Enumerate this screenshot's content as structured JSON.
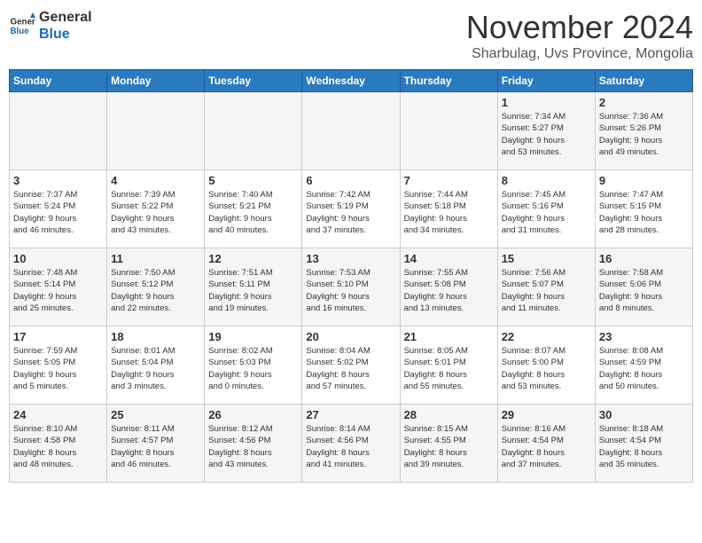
{
  "logo": {
    "general": "General",
    "blue": "Blue"
  },
  "title": "November 2024",
  "location": "Sharbulag, Uvs Province, Mongolia",
  "days_header": [
    "Sunday",
    "Monday",
    "Tuesday",
    "Wednesday",
    "Thursday",
    "Friday",
    "Saturday"
  ],
  "weeks": [
    [
      {
        "day": "",
        "info": ""
      },
      {
        "day": "",
        "info": ""
      },
      {
        "day": "",
        "info": ""
      },
      {
        "day": "",
        "info": ""
      },
      {
        "day": "",
        "info": ""
      },
      {
        "day": "1",
        "info": "Sunrise: 7:34 AM\nSunset: 5:27 PM\nDaylight: 9 hours\nand 53 minutes."
      },
      {
        "day": "2",
        "info": "Sunrise: 7:36 AM\nSunset: 5:26 PM\nDaylight: 9 hours\nand 49 minutes."
      }
    ],
    [
      {
        "day": "3",
        "info": "Sunrise: 7:37 AM\nSunset: 5:24 PM\nDaylight: 9 hours\nand 46 minutes."
      },
      {
        "day": "4",
        "info": "Sunrise: 7:39 AM\nSunset: 5:22 PM\nDaylight: 9 hours\nand 43 minutes."
      },
      {
        "day": "5",
        "info": "Sunrise: 7:40 AM\nSunset: 5:21 PM\nDaylight: 9 hours\nand 40 minutes."
      },
      {
        "day": "6",
        "info": "Sunrise: 7:42 AM\nSunset: 5:19 PM\nDaylight: 9 hours\nand 37 minutes."
      },
      {
        "day": "7",
        "info": "Sunrise: 7:44 AM\nSunset: 5:18 PM\nDaylight: 9 hours\nand 34 minutes."
      },
      {
        "day": "8",
        "info": "Sunrise: 7:45 AM\nSunset: 5:16 PM\nDaylight: 9 hours\nand 31 minutes."
      },
      {
        "day": "9",
        "info": "Sunrise: 7:47 AM\nSunset: 5:15 PM\nDaylight: 9 hours\nand 28 minutes."
      }
    ],
    [
      {
        "day": "10",
        "info": "Sunrise: 7:48 AM\nSunset: 5:14 PM\nDaylight: 9 hours\nand 25 minutes."
      },
      {
        "day": "11",
        "info": "Sunrise: 7:50 AM\nSunset: 5:12 PM\nDaylight: 9 hours\nand 22 minutes."
      },
      {
        "day": "12",
        "info": "Sunrise: 7:51 AM\nSunset: 5:11 PM\nDaylight: 9 hours\nand 19 minutes."
      },
      {
        "day": "13",
        "info": "Sunrise: 7:53 AM\nSunset: 5:10 PM\nDaylight: 9 hours\nand 16 minutes."
      },
      {
        "day": "14",
        "info": "Sunrise: 7:55 AM\nSunset: 5:08 PM\nDaylight: 9 hours\nand 13 minutes."
      },
      {
        "day": "15",
        "info": "Sunrise: 7:56 AM\nSunset: 5:07 PM\nDaylight: 9 hours\nand 11 minutes."
      },
      {
        "day": "16",
        "info": "Sunrise: 7:58 AM\nSunset: 5:06 PM\nDaylight: 9 hours\nand 8 minutes."
      }
    ],
    [
      {
        "day": "17",
        "info": "Sunrise: 7:59 AM\nSunset: 5:05 PM\nDaylight: 9 hours\nand 5 minutes."
      },
      {
        "day": "18",
        "info": "Sunrise: 8:01 AM\nSunset: 5:04 PM\nDaylight: 9 hours\nand 3 minutes."
      },
      {
        "day": "19",
        "info": "Sunrise: 8:02 AM\nSunset: 5:03 PM\nDaylight: 9 hours\nand 0 minutes."
      },
      {
        "day": "20",
        "info": "Sunrise: 8:04 AM\nSunset: 5:02 PM\nDaylight: 8 hours\nand 57 minutes."
      },
      {
        "day": "21",
        "info": "Sunrise: 8:05 AM\nSunset: 5:01 PM\nDaylight: 8 hours\nand 55 minutes."
      },
      {
        "day": "22",
        "info": "Sunrise: 8:07 AM\nSunset: 5:00 PM\nDaylight: 8 hours\nand 53 minutes."
      },
      {
        "day": "23",
        "info": "Sunrise: 8:08 AM\nSunset: 4:59 PM\nDaylight: 8 hours\nand 50 minutes."
      }
    ],
    [
      {
        "day": "24",
        "info": "Sunrise: 8:10 AM\nSunset: 4:58 PM\nDaylight: 8 hours\nand 48 minutes."
      },
      {
        "day": "25",
        "info": "Sunrise: 8:11 AM\nSunset: 4:57 PM\nDaylight: 8 hours\nand 46 minutes."
      },
      {
        "day": "26",
        "info": "Sunrise: 8:12 AM\nSunset: 4:56 PM\nDaylight: 8 hours\nand 43 minutes."
      },
      {
        "day": "27",
        "info": "Sunrise: 8:14 AM\nSunset: 4:56 PM\nDaylight: 8 hours\nand 41 minutes."
      },
      {
        "day": "28",
        "info": "Sunrise: 8:15 AM\nSunset: 4:55 PM\nDaylight: 8 hours\nand 39 minutes."
      },
      {
        "day": "29",
        "info": "Sunrise: 8:16 AM\nSunset: 4:54 PM\nDaylight: 8 hours\nand 37 minutes."
      },
      {
        "day": "30",
        "info": "Sunrise: 8:18 AM\nSunset: 4:54 PM\nDaylight: 8 hours\nand 35 minutes."
      }
    ]
  ]
}
